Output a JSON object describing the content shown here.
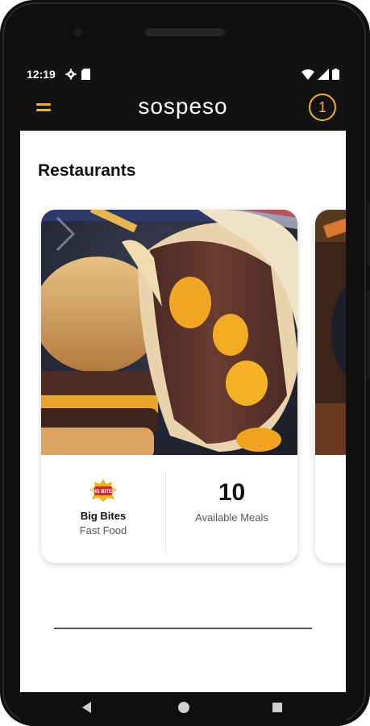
{
  "status": {
    "time": "12:19",
    "left_icons": [
      "gear-icon",
      "sd-card-icon"
    ],
    "right_icons": [
      "wifi-icon",
      "signal-icon",
      "battery-icon"
    ]
  },
  "app": {
    "title": "sospeso",
    "badge_count": "1",
    "accent_color": "#f2b21b",
    "bar_color": "#121212"
  },
  "main": {
    "section_title": "Restaurants",
    "cards": [
      {
        "name": "Big Bites",
        "type": "Fast Food",
        "meals_count": "10",
        "meals_label": "Available Meals",
        "logo_text": "BIG BITES"
      }
    ]
  },
  "navbar": {
    "buttons": [
      "back-icon",
      "home-icon",
      "recents-icon"
    ]
  }
}
